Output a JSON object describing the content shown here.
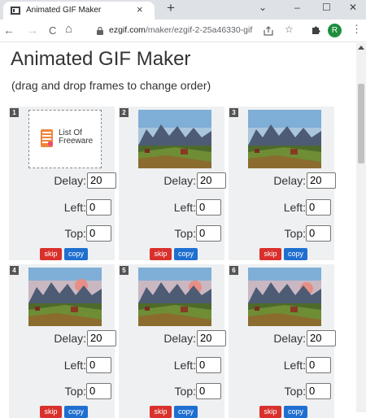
{
  "browser": {
    "tab_title": "Animated GIF Maker",
    "tab_close": "×",
    "new_tab": "+",
    "controls": {
      "dropdown": "⌄",
      "minimize": "–",
      "maximize": "☐",
      "close": "✕"
    },
    "nav": {
      "back": "←",
      "forward": "→",
      "reload": "C",
      "home": "⌂"
    },
    "url_domain": "ezgif.com",
    "url_path": "/maker/ezgif-2-25a46330-gif",
    "profile_initial": "R",
    "menu": "⋮"
  },
  "page": {
    "title": "Animated GIF Maker",
    "subtitle": "(drag and drop frames to change order)"
  },
  "labels": {
    "delay": "Delay:",
    "left": "Left:",
    "top": "Top:",
    "skip": "skip",
    "copy": "copy"
  },
  "logo_text": {
    "line1": "List Of",
    "line2": "Freeware"
  },
  "frames": [
    {
      "number": "1",
      "type": "logo",
      "delay": "20",
      "left": "0",
      "top": "0"
    },
    {
      "number": "2",
      "type": "landscape",
      "delay": "20",
      "left": "0",
      "top": "0"
    },
    {
      "number": "3",
      "type": "landscape",
      "delay": "20",
      "left": "0",
      "top": "0"
    },
    {
      "number": "4",
      "type": "landscape",
      "delay": "20",
      "left": "0",
      "top": "0"
    },
    {
      "number": "5",
      "type": "landscape",
      "delay": "20",
      "left": "0",
      "top": "0"
    },
    {
      "number": "6",
      "type": "landscape",
      "delay": "20",
      "left": "0",
      "top": "0"
    }
  ],
  "colors": {
    "skip": "#d9302c",
    "copy": "#1f6fd0",
    "frame_bg": "#eef0f2",
    "avatar": "#1e8e3e"
  }
}
